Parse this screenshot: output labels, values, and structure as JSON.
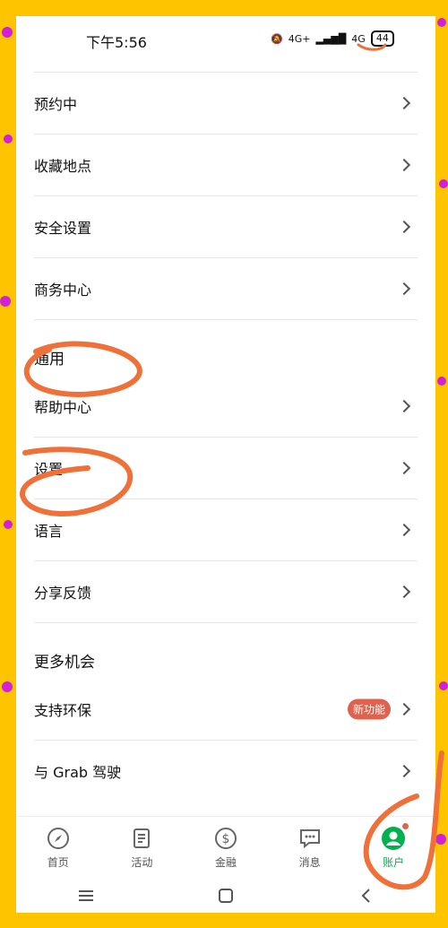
{
  "status_bar": {
    "time": "下午5:56",
    "network": "4G+",
    "network2": "4G",
    "battery": "44"
  },
  "menu": {
    "group1": [
      {
        "label": "预约中"
      },
      {
        "label": "收藏地点"
      },
      {
        "label": "安全设置"
      },
      {
        "label": "商务中心"
      }
    ],
    "section_general": "通用",
    "group2": [
      {
        "label": "帮助中心"
      },
      {
        "label": "设置"
      },
      {
        "label": "语言"
      },
      {
        "label": "分享反馈"
      }
    ],
    "section_more": "更多机会",
    "group3": [
      {
        "label": "支持环保",
        "badge": "新功能"
      },
      {
        "label": "与 Grab 驾驶"
      }
    ]
  },
  "bottom_nav": {
    "home": "首页",
    "activity": "活动",
    "finance": "金融",
    "messages": "消息",
    "account": "账户"
  },
  "colors": {
    "accent": "#00b14f",
    "annotation": "#f0703a",
    "badge": "#e0614e",
    "background": "#ffc400"
  }
}
